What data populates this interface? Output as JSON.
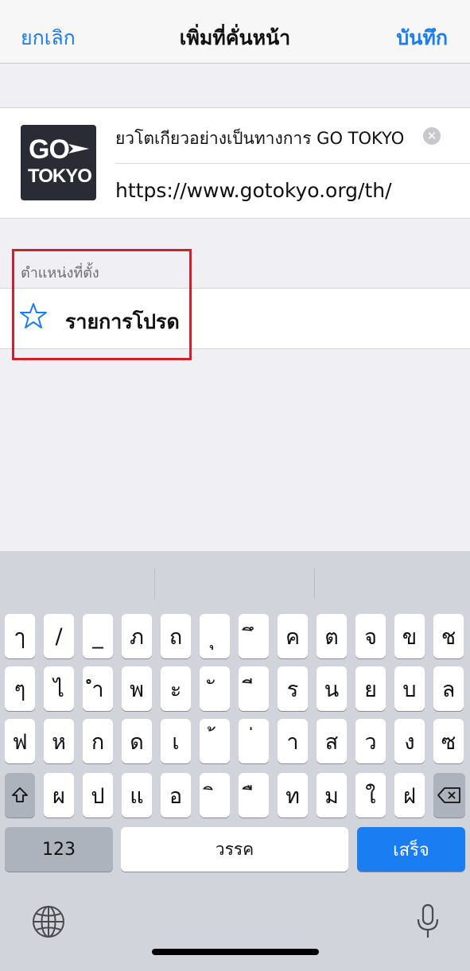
{
  "navbar": {
    "cancel_label": "ยกเลิก",
    "title": "เพิ่มที่คั่นหน้า",
    "save_label": "บันทึก"
  },
  "bookmark": {
    "logo_line1": "GO",
    "logo_line2": "TOKYO",
    "title_value": "ยวโตเกียวอย่างเป็นทางการ GO TOKYO",
    "url_value": "https://www.gotokyo.org/th/",
    "clear_icon": "clear-x-icon"
  },
  "location": {
    "header": "ตำแหน่งที่ตั้ง",
    "folder_label": "รายการโปรด",
    "folder_icon": "star-icon"
  },
  "keyboard": {
    "row1": [
      "ๅ",
      "/",
      "_",
      "ภ",
      "ถ",
      "ุ",
      "ึ",
      "ค",
      "ต",
      "จ",
      "ข",
      "ช"
    ],
    "row2": [
      "ๆ",
      "ไ",
      "ำ",
      "พ",
      "ะ",
      "ั",
      "ี",
      "ร",
      "น",
      "ย",
      "บ",
      "ล"
    ],
    "row3": [
      "ฟ",
      "ห",
      "ก",
      "ด",
      "เ",
      "้",
      "่",
      "า",
      "ส",
      "ว",
      "ง",
      "ซ"
    ],
    "row4": [
      "ผ",
      "ป",
      "แ",
      "อ",
      "ิ",
      "ื",
      "ท",
      "ม",
      "ใ",
      "ฝ"
    ],
    "numbers_label": "123",
    "space_label": "วรรค",
    "done_label": "เสร็จ"
  },
  "colors": {
    "accent": "#1a7ef2",
    "highlight": "#d0202e"
  }
}
